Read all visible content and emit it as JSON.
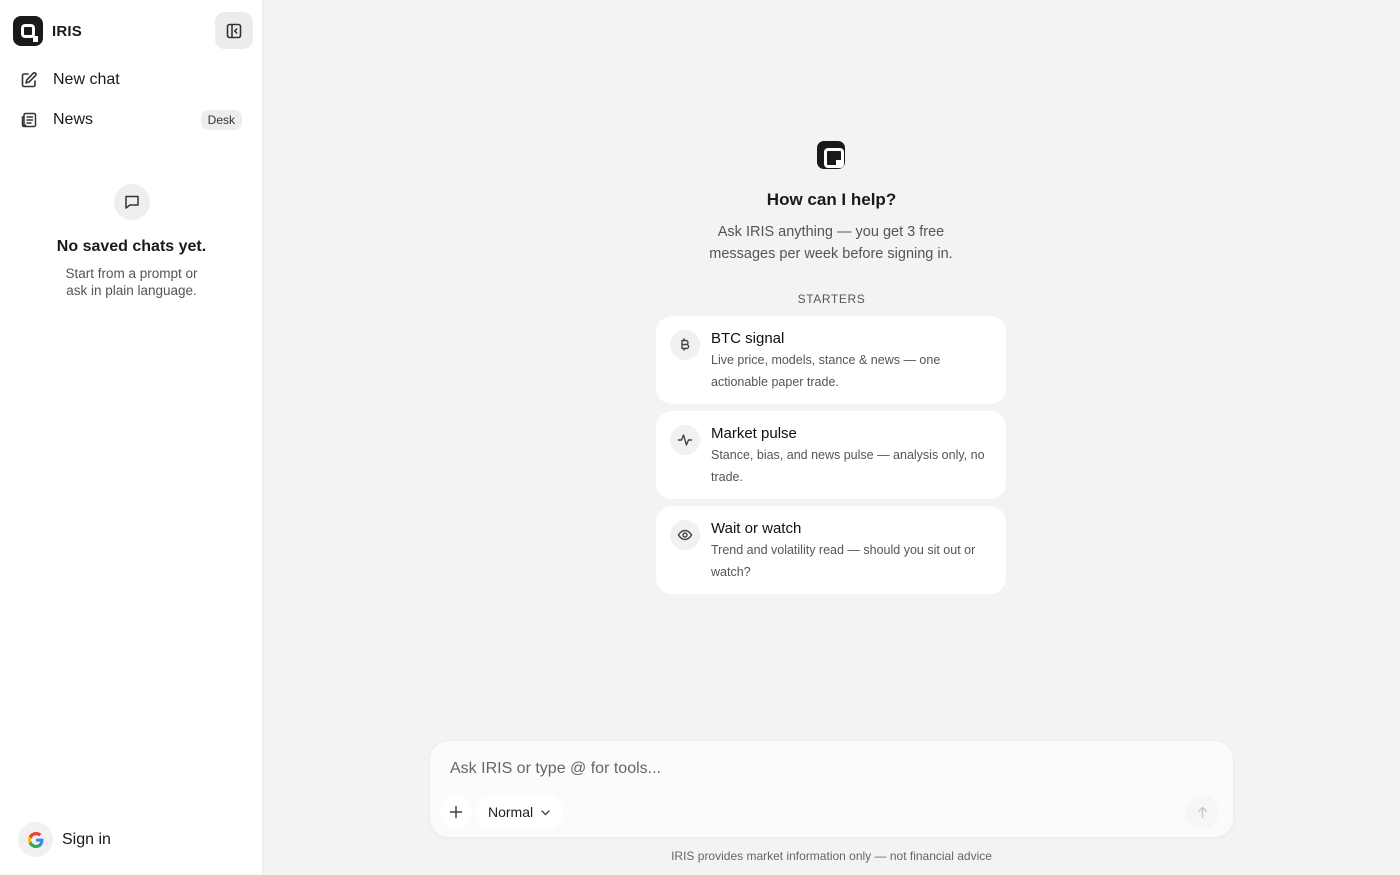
{
  "sidebar": {
    "brand": "IRIS",
    "nav": [
      {
        "label": "New chat",
        "icon": "edit-icon"
      },
      {
        "label": "News",
        "icon": "newspaper-icon",
        "badge": "Desk"
      }
    ],
    "empty_state": {
      "title": "No saved chats yet.",
      "subtitle_line1": "Start from a prompt or",
      "subtitle_line2": "ask in plain language."
    },
    "sign_in_label": "Sign in"
  },
  "main": {
    "title": "How can I help?",
    "subtitle_line1": "Ask IRIS anything — you get 3 free",
    "subtitle_line2": "messages per week before signing in.",
    "starters_label": "STARTERS",
    "starters": [
      {
        "title": "BTC signal",
        "desc_line1": "Live price, models, stance & news — one",
        "desc_line2": "actionable paper trade.",
        "icon": "bitcoin-icon"
      },
      {
        "title": "Market pulse",
        "desc_line1": "Stance, bias, and news pulse — analysis only, no",
        "desc_line2": "trade.",
        "icon": "activity-icon"
      },
      {
        "title": "Wait or watch",
        "desc_line1": "Trend and volatility read — should you sit out or",
        "desc_line2": "watch?",
        "icon": "eye-icon"
      }
    ],
    "composer": {
      "placeholder": "Ask IRIS or type @ for tools...",
      "mode": "Normal"
    },
    "disclaimer": "IRIS provides market information only — not financial advice"
  },
  "colors": {
    "sidebar_bg": "#ffffff",
    "main_bg": "#f3f3f3",
    "text": "#1a1a1a",
    "muted": "#555555"
  }
}
